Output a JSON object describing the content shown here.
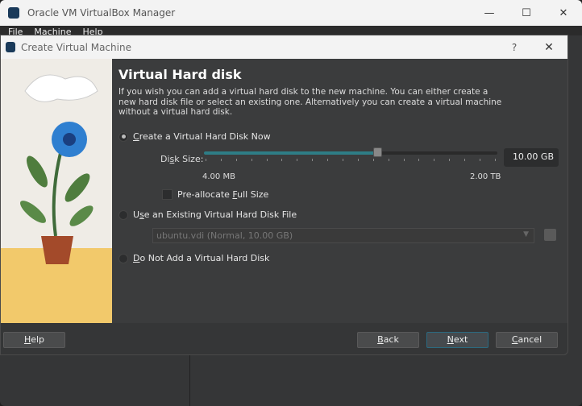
{
  "main_window": {
    "title": "Oracle VM VirtualBox Manager",
    "menu": [
      "File",
      "Machine",
      "Help"
    ],
    "controls": {
      "minimize": "—",
      "maximize": "☐",
      "close": "✕"
    }
  },
  "dialog": {
    "title": "Create Virtual Machine",
    "help_glyph": "?",
    "close_glyph": "✕",
    "heading": "Virtual Hard disk",
    "description": "If you wish you can add a virtual hard disk to the new machine. You can either create a new hard disk file or select an existing one. Alternatively you can create a virtual machine without a virtual hard disk.",
    "options": {
      "create": {
        "pre": "",
        "u": "C",
        "post": "reate a Virtual Hard Disk Now",
        "selected": true
      },
      "existing": {
        "pre": "U",
        "u": "s",
        "post": "e an Existing Virtual Hard Disk File",
        "selected": false
      },
      "none": {
        "pre": "",
        "u": "D",
        "post": "o Not Add a Virtual Hard Disk",
        "selected": false
      }
    },
    "disk_size": {
      "label_pre": "Di",
      "label_u": "s",
      "label_post": "k Size:",
      "value": "10.00 GB",
      "min_label": "4.00 MB",
      "max_label": "2.00 TB",
      "slider_fraction": 0.59
    },
    "preallocate": {
      "pre": "Pre-allocate ",
      "u": "F",
      "post": "ull Size",
      "checked": false
    },
    "existing_file": "ubuntu.vdi (Normal, 10.00 GB)",
    "buttons": {
      "help": {
        "u": "H",
        "post": "elp"
      },
      "back": {
        "u": "B",
        "post": "ack"
      },
      "next": {
        "u": "N",
        "post": "ext"
      },
      "cancel": {
        "u": "C",
        "post": "ancel"
      }
    }
  },
  "colors": {
    "accent": "#2e7d86"
  }
}
